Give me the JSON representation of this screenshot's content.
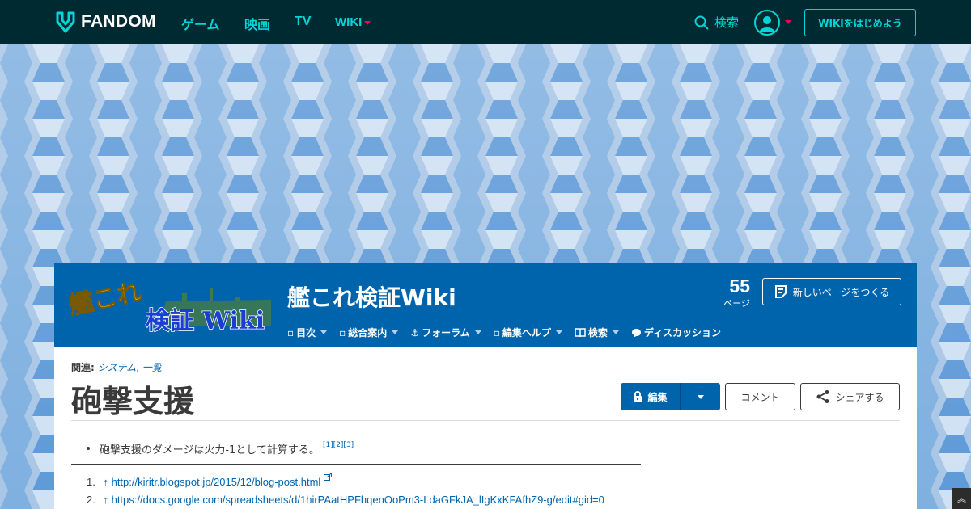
{
  "global_nav": {
    "brand": "FANDOM",
    "links": [
      "ゲーム",
      "映画",
      "TV"
    ],
    "wiki_label": "WIKI",
    "search_label": "検索",
    "start_wiki": "WIKIをはじめよう"
  },
  "community": {
    "wordmark_lines": [
      "艦これ",
      "検証 Wiki"
    ],
    "name": "艦これ検証Wiki",
    "pages_count": "55",
    "pages_label": "ページ",
    "new_page": "新しいページをつくる",
    "nav": [
      {
        "icon": "list-icon",
        "label": "目次"
      },
      {
        "icon": "info-icon",
        "label": "総合案内"
      },
      {
        "icon": "anchor-icon",
        "label": "フォーラム"
      },
      {
        "icon": "help-icon",
        "label": "編集ヘルプ"
      },
      {
        "icon": "book-icon",
        "label": "検索"
      },
      {
        "icon": "bubble-icon",
        "label": "ディスカッション"
      }
    ]
  },
  "article": {
    "related_label": "関連:",
    "related_links": [
      "システム",
      "一覧"
    ],
    "title": "砲撃支援",
    "edit": "編集",
    "comment": "コメント",
    "share": "シェアする",
    "bullet": "砲撃支援のダメージは火力-1として計算する。",
    "bullet_refs": "[1][2][3]",
    "references": [
      {
        "n": "1.",
        "arrow": "↑",
        "url": "http://kiritr.blogspot.jp/2015/12/blog-post.html"
      },
      {
        "n": "2.",
        "arrow": "↑",
        "url": "https://docs.google.com/spreadsheets/d/1hirPAatHPFhqenOoPm3-LdaGFkJA_lIgKxKFAfhZ9-g/edit#gid=0"
      }
    ]
  },
  "colors": {
    "top_nav": "#002a32",
    "accent_teal": "#00d6d6",
    "community_blue": "#0064ad",
    "accent_red": "#fa005a"
  }
}
